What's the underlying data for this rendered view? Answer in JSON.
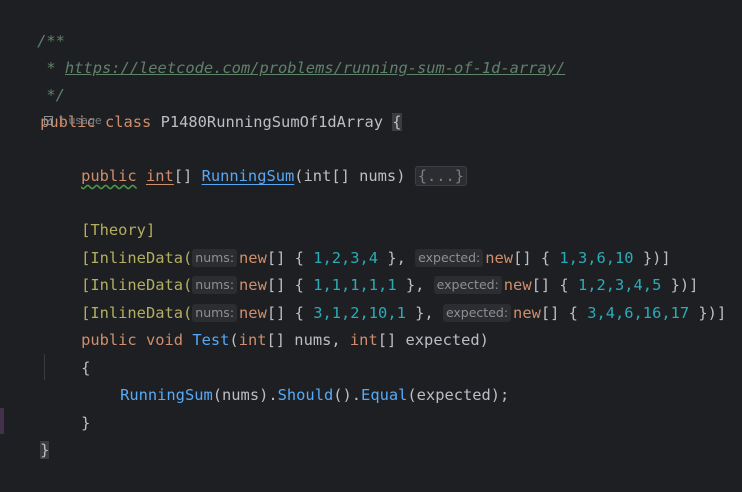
{
  "comment": {
    "open": "/**",
    "star": " * ",
    "url": "https://leetcode.com/problems/running-sum-of-1d-array/",
    "close": " */"
  },
  "class_line": {
    "kw_public": "public",
    "kw_class": "class",
    "class_name": "P1480RunningSumOf1dArray",
    "brace": "{"
  },
  "usage_hint": "1 usage",
  "method_line": {
    "kw_public": "public",
    "type": "int",
    "arr": "[] ",
    "name": "RunningSum",
    "params": "(int[] nums) ",
    "fold": "{...}"
  },
  "attributes": {
    "theory": "[Theory]",
    "inline_rows": [
      {
        "prefix": "[InlineData(",
        "hint1": "nums:",
        "new1": "new",
        "arr1": "[] { ",
        "nums": "1,2,3,4",
        "mid": " }, ",
        "hint2": "expected:",
        "new2": "new",
        "arr2": "[] { ",
        "expected": "1,3,6,10",
        "end": " })]"
      },
      {
        "prefix": "[InlineData(",
        "hint1": "nums:",
        "new1": "new",
        "arr1": "[] { ",
        "nums": "1,1,1,1,1",
        "mid": " }, ",
        "hint2": "expected:",
        "new2": "new",
        "arr2": "[] { ",
        "expected": "1,2,3,4,5",
        "end": " })]"
      },
      {
        "prefix": "[InlineData(",
        "hint1": "nums:",
        "new1": "new",
        "arr1": "[] { ",
        "nums": "3,1,2,10,1",
        "mid": " }, ",
        "hint2": "expected:",
        "new2": "new",
        "arr2": "[] { ",
        "expected": "3,4,6,16,17",
        "end": " })]"
      }
    ]
  },
  "test_method": {
    "kw_public": "public",
    "kw_void": "void",
    "name": "Test",
    "p_open": "(",
    "t1": "int",
    "p1": "[] nums, ",
    "t2": "int",
    "p2": "[] expected)",
    "open_brace": "{",
    "body_call": "RunningSum",
    "body_arg": "(nums).",
    "body_should": "Should",
    "body_mid": "().",
    "body_equal": "Equal",
    "body_end": "(expected);",
    "close_brace": "}"
  },
  "class_close": "}"
}
